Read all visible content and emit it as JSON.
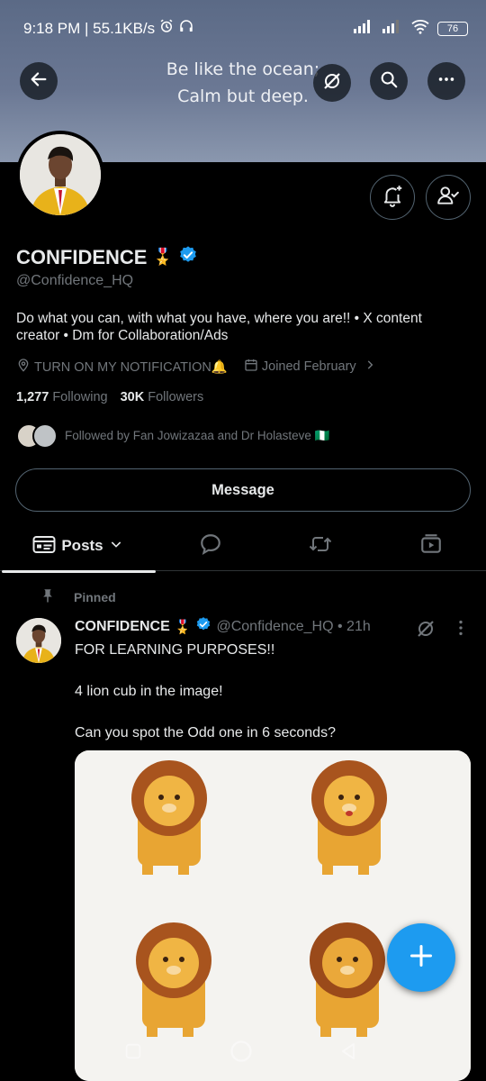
{
  "status": {
    "time_speed": "9:18 PM | 55.1KB/s",
    "battery": "76"
  },
  "banner": {
    "quote_line1": "Be like the ocean;",
    "quote_line2": "Calm but deep."
  },
  "profile": {
    "name": "CONFIDENCE",
    "medal": "🎖️",
    "handle": "@Confidence_HQ",
    "bio": "Do what you can, with what you have, where you are!! • X content creator • Dm for Collaboration/Ads",
    "location": "TURN ON MY NOTIFICATION🔔",
    "joined": "Joined February",
    "following_count": "1,277",
    "following_label": "Following",
    "followers_count": "30K",
    "followers_label": "Followers",
    "followed_by": "Followed by Fan Jowizazaa and Dr Holasteve 🇳🇬",
    "message_label": "Message"
  },
  "tabs": {
    "posts_label": "Posts"
  },
  "post": {
    "pinned_label": "Pinned",
    "name": "CONFIDENCE",
    "medal": "🎖️",
    "handle_time": "@Confidence_HQ • 21h",
    "line1": "FOR LEARNING PURPOSES!!",
    "line2": "4 lion cub in the image!",
    "line3": "Can you spot the Odd one in 6 seconds?"
  },
  "colors": {
    "accent": "#1d9bf0",
    "background": "#000000",
    "muted": "#71767b"
  }
}
